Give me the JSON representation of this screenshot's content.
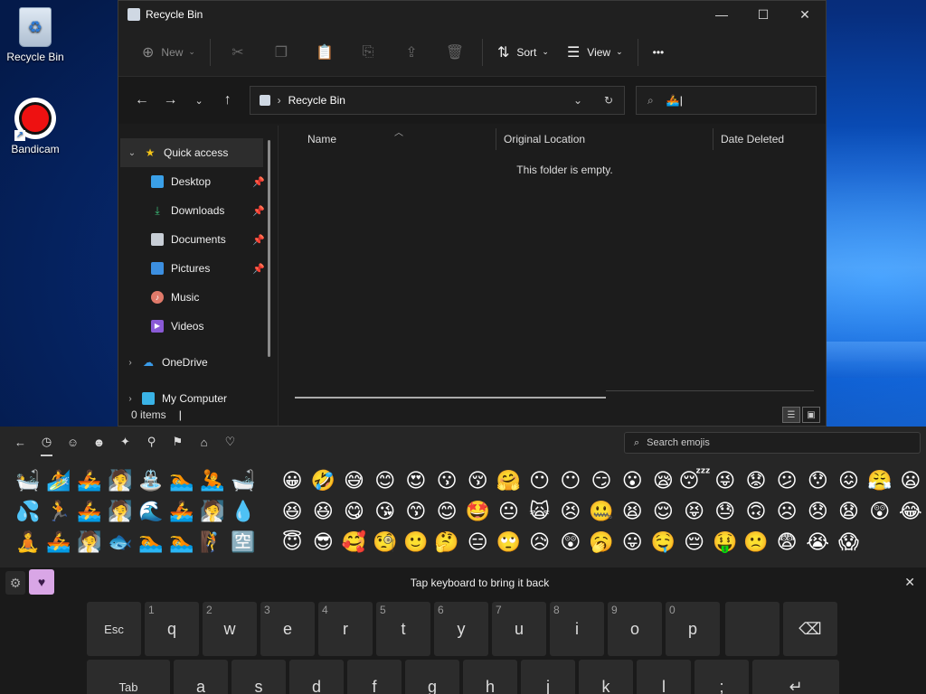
{
  "desktop": {
    "icons": [
      {
        "label": "Recycle Bin"
      },
      {
        "label": "Bandicam"
      }
    ]
  },
  "explorer": {
    "title": "Recycle Bin",
    "commands": {
      "new": "New",
      "sort": "Sort",
      "view": "View",
      "more": "•••"
    },
    "address": {
      "path": "Recycle Bin"
    },
    "search": {
      "value": "🚣"
    },
    "nav": {
      "quick_access": "Quick access",
      "items": [
        {
          "label": "Desktop",
          "pinned": true
        },
        {
          "label": "Downloads",
          "pinned": true
        },
        {
          "label": "Documents",
          "pinned": true
        },
        {
          "label": "Pictures",
          "pinned": true
        },
        {
          "label": "Music",
          "pinned": false
        },
        {
          "label": "Videos",
          "pinned": false
        }
      ],
      "onedrive": "OneDrive",
      "my_computer": "My Computer"
    },
    "columns": {
      "name": "Name",
      "original_location": "Original Location",
      "date_deleted": "Date Deleted"
    },
    "empty_message": "This folder is empty.",
    "status": "0 items"
  },
  "emoji_panel": {
    "search_placeholder": "Search emojis",
    "tabs": [
      "back",
      "recent",
      "smileys",
      "people",
      "celebration",
      "food",
      "travel",
      "objects",
      "heart"
    ],
    "recent": [
      "🛀",
      "🏄",
      "🚣",
      "🧖",
      "⛲",
      "🏊",
      "🤽",
      "🛁",
      "💦",
      "🏃",
      "🚣",
      "🧖",
      "🌊",
      "🚣",
      "🧖",
      "💧",
      "🧘",
      "🚣",
      "🧖",
      "🐟",
      "🏊",
      "🏊",
      "🧗",
      "🈳"
    ],
    "smileys": [
      "😀",
      "🤣",
      "😅",
      "😊",
      "😍",
      "😗",
      "😚",
      "🤗",
      "😶",
      "😶",
      "😏",
      "😮",
      "😪",
      "😴",
      "😜",
      "😟",
      "😕",
      "😯",
      "😖",
      "😤",
      "😦",
      "😃",
      "😆",
      "😆",
      "😋",
      "😘",
      "😙",
      "😊",
      "🤩",
      "😐",
      "🙀",
      "😣",
      "🤐",
      "😫",
      "😌",
      "😝",
      "😓",
      "🙃",
      "☹",
      "😞",
      "😧",
      "😲",
      "😂",
      "😄",
      "😇",
      "😎",
      "🥰",
      "🧐",
      "🙂",
      "🤔",
      "😑",
      "🙄",
      "😥",
      "😲",
      "🥱",
      "😛",
      "🤤",
      "😔",
      "🤑",
      "🙁",
      "😨",
      "😭",
      "😱"
    ]
  },
  "keyboard": {
    "message": "Tap keyboard to bring it back",
    "row1": [
      {
        "label": "Esc",
        "hint": ""
      },
      {
        "label": "q",
        "hint": "1"
      },
      {
        "label": "w",
        "hint": "2"
      },
      {
        "label": "e",
        "hint": "3"
      },
      {
        "label": "r",
        "hint": "4"
      },
      {
        "label": "t",
        "hint": "5"
      },
      {
        "label": "y",
        "hint": "6"
      },
      {
        "label": "u",
        "hint": "7"
      },
      {
        "label": "i",
        "hint": "8"
      },
      {
        "label": "o",
        "hint": "9"
      },
      {
        "label": "p",
        "hint": "0"
      },
      {
        "label": "",
        "hint": ""
      },
      {
        "label": "⌫",
        "hint": ""
      }
    ],
    "row2": [
      {
        "label": "Tab"
      },
      {
        "label": "a"
      },
      {
        "label": "s"
      },
      {
        "label": "d"
      },
      {
        "label": "f"
      },
      {
        "label": "g"
      },
      {
        "label": "h"
      },
      {
        "label": "j"
      },
      {
        "label": "k"
      },
      {
        "label": "l"
      },
      {
        "label": ";"
      },
      {
        "label": "↵"
      }
    ]
  }
}
